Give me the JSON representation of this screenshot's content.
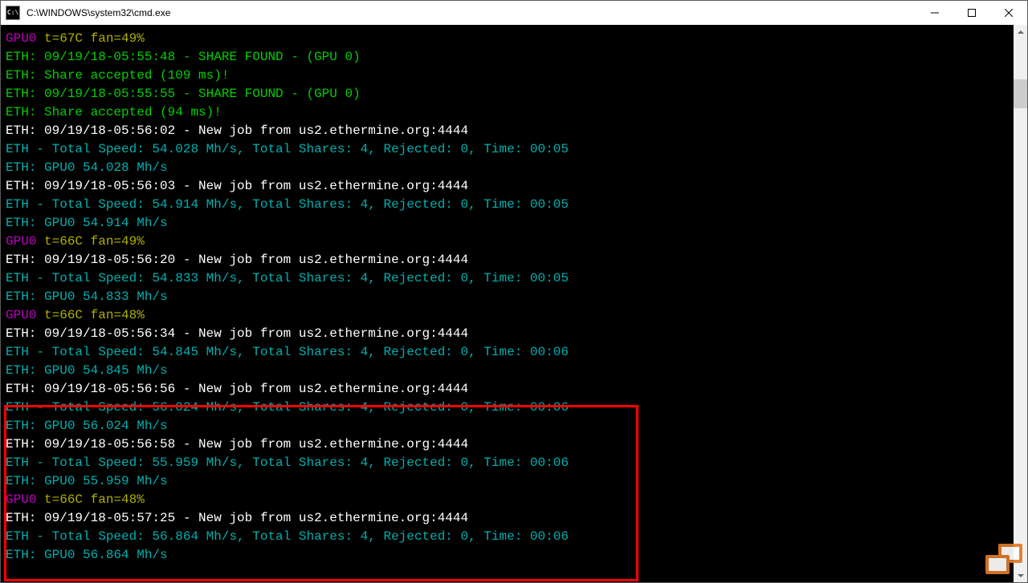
{
  "window": {
    "title": "C:\\WINDOWS\\system32\\cmd.exe",
    "icon_text": "C:\\"
  },
  "colors": {
    "magenta": "#c000c0",
    "olive": "#b0b000",
    "green": "#00d000",
    "white": "#ffffff",
    "teal": "#00b0b0"
  },
  "lines": [
    {
      "spans": [
        {
          "c": "magenta",
          "t": "GPU0"
        },
        {
          "c": "olive",
          "t": " t=67C fan=49%"
        }
      ]
    },
    {
      "spans": [
        {
          "c": "green",
          "t": "ETH: 09/19/18-05:55:48 - SHARE FOUND - (GPU 0)"
        }
      ]
    },
    {
      "spans": [
        {
          "c": "green",
          "t": "ETH: Share accepted (109 ms)!"
        }
      ]
    },
    {
      "spans": [
        {
          "c": "green",
          "t": "ETH: 09/19/18-05:55:55 - SHARE FOUND - (GPU 0)"
        }
      ]
    },
    {
      "spans": [
        {
          "c": "green",
          "t": "ETH: Share accepted (94 ms)!"
        }
      ]
    },
    {
      "spans": [
        {
          "c": "white",
          "t": "ETH: 09/19/18-05:56:02 - New job from us2.ethermine.org:4444"
        }
      ]
    },
    {
      "spans": [
        {
          "c": "teal",
          "t": "ETH - Total Speed: 54.028 Mh/s, Total Shares: 4, Rejected: 0, Time: 00:05"
        }
      ]
    },
    {
      "spans": [
        {
          "c": "teal",
          "t": "ETH: GPU0 54.028 Mh/s"
        }
      ]
    },
    {
      "spans": [
        {
          "c": "white",
          "t": "ETH: 09/19/18-05:56:03 - New job from us2.ethermine.org:4444"
        }
      ]
    },
    {
      "spans": [
        {
          "c": "teal",
          "t": "ETH - Total Speed: 54.914 Mh/s, Total Shares: 4, Rejected: 0, Time: 00:05"
        }
      ]
    },
    {
      "spans": [
        {
          "c": "teal",
          "t": "ETH: GPU0 54.914 Mh/s"
        }
      ]
    },
    {
      "spans": [
        {
          "c": "magenta",
          "t": "GPU0"
        },
        {
          "c": "olive",
          "t": " t=66C fan=49%"
        }
      ]
    },
    {
      "spans": [
        {
          "c": "white",
          "t": "ETH: 09/19/18-05:56:20 - New job from us2.ethermine.org:4444"
        }
      ]
    },
    {
      "spans": [
        {
          "c": "teal",
          "t": "ETH - Total Speed: 54.833 Mh/s, Total Shares: 4, Rejected: 0, Time: 00:05"
        }
      ]
    },
    {
      "spans": [
        {
          "c": "teal",
          "t": "ETH: GPU0 54.833 Mh/s"
        }
      ]
    },
    {
      "spans": [
        {
          "c": "magenta",
          "t": "GPU0"
        },
        {
          "c": "olive",
          "t": " t=66C fan=48%"
        }
      ]
    },
    {
      "spans": [
        {
          "c": "white",
          "t": "ETH: 09/19/18-05:56:34 - New job from us2.ethermine.org:4444"
        }
      ]
    },
    {
      "spans": [
        {
          "c": "teal",
          "t": "ETH - Total Speed: 54.845 Mh/s, Total Shares: 4, Rejected: 0, Time: 00:06"
        }
      ]
    },
    {
      "spans": [
        {
          "c": "teal",
          "t": "ETH: GPU0 54.845 Mh/s"
        }
      ]
    },
    {
      "spans": [
        {
          "c": "white",
          "t": "ETH: 09/19/18-05:56:56 - New job from us2.ethermine.org:4444"
        }
      ]
    },
    {
      "spans": [
        {
          "c": "teal",
          "t": "ETH - Total Speed: 56.024 Mh/s, Total Shares: 4, Rejected: 0, Time: 00:06"
        }
      ]
    },
    {
      "spans": [
        {
          "c": "teal",
          "t": "ETH: GPU0 56.024 Mh/s"
        }
      ]
    },
    {
      "spans": [
        {
          "c": "white",
          "t": "ETH: 09/19/18-05:56:58 - New job from us2.ethermine.org:4444"
        }
      ]
    },
    {
      "spans": [
        {
          "c": "teal",
          "t": "ETH - Total Speed: 55.959 Mh/s, Total Shares: 4, Rejected: 0, Time: 00:06"
        }
      ]
    },
    {
      "spans": [
        {
          "c": "teal",
          "t": "ETH: GPU0 55.959 Mh/s"
        }
      ]
    },
    {
      "spans": [
        {
          "c": "magenta",
          "t": "GPU0"
        },
        {
          "c": "olive",
          "t": " t=66C fan=48%"
        }
      ]
    },
    {
      "spans": [
        {
          "c": "white",
          "t": "ETH: 09/19/18-05:57:25 - New job from us2.ethermine.org:4444"
        }
      ]
    },
    {
      "spans": [
        {
          "c": "teal",
          "t": "ETH - Total Speed: 56.864 Mh/s, Total Shares: 4, Rejected: 0, Time: 00:06"
        }
      ]
    },
    {
      "spans": [
        {
          "c": "teal",
          "t": "ETH: GPU0 56.864 Mh/s"
        }
      ]
    }
  ]
}
